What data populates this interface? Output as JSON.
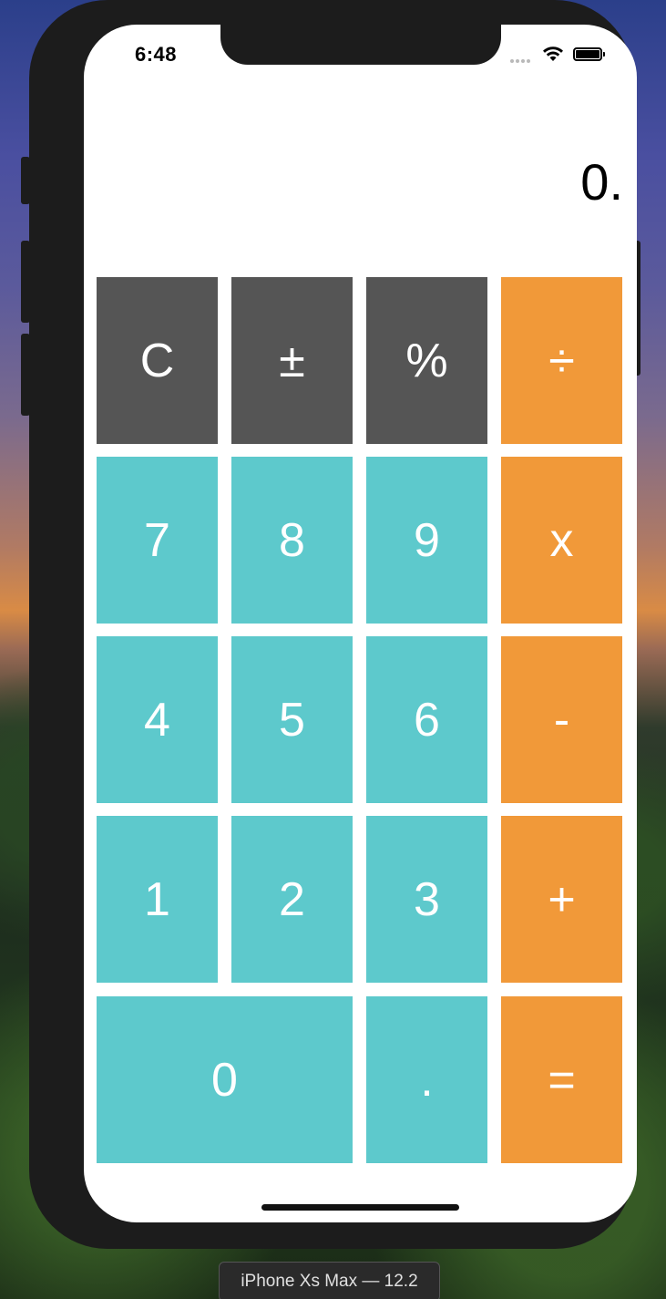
{
  "status_bar": {
    "time": "6:48",
    "icons": [
      "cellular-signal-icon",
      "wifi-icon",
      "battery-icon"
    ]
  },
  "display": {
    "value": "0."
  },
  "keys": {
    "clear": "C",
    "plus_minus": "±",
    "percent": "%",
    "divide": "÷",
    "seven": "7",
    "eight": "8",
    "nine": "9",
    "multiply": "x",
    "four": "4",
    "five": "5",
    "six": "6",
    "subtract": "-",
    "one": "1",
    "two": "2",
    "three": "3",
    "add": "+",
    "zero": "0",
    "decimal": ".",
    "equals": "="
  },
  "colors": {
    "function_key": "#555555",
    "digit_key": "#5dc9cc",
    "operator_key": "#f19939"
  },
  "simulator": {
    "device_label": "iPhone Xs Max — 12.2"
  }
}
